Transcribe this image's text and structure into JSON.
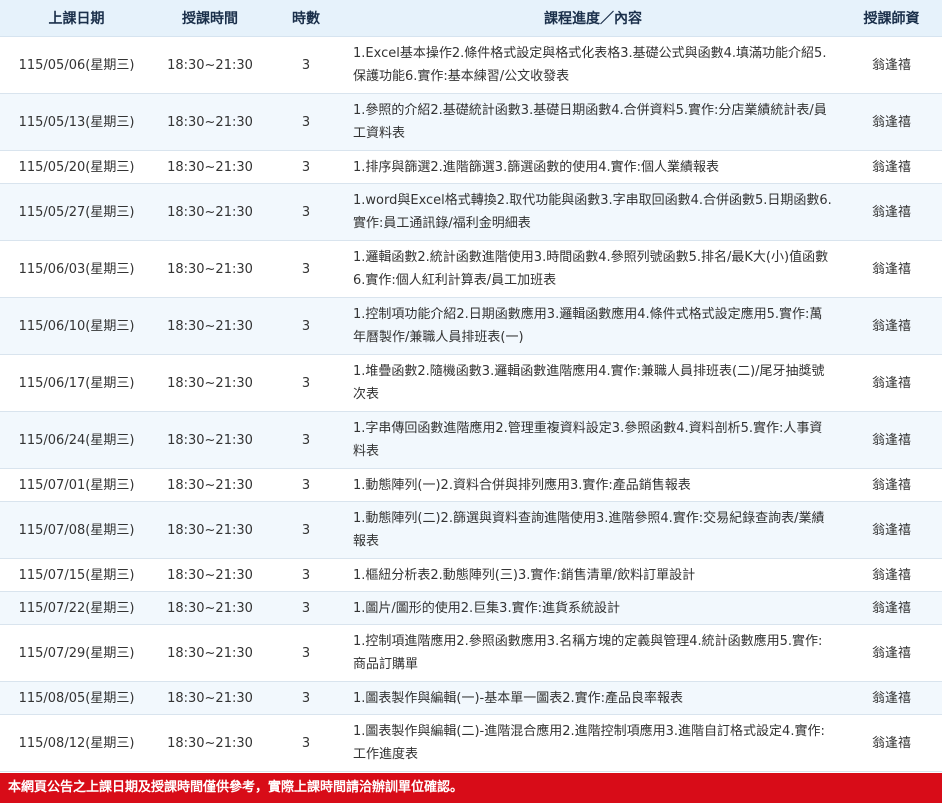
{
  "headers": [
    "上課日期",
    "授課時間",
    "時數",
    "課程進度／內容",
    "授課師資"
  ],
  "rows": [
    {
      "date": "115/05/06(星期三)",
      "time": "18:30~21:30",
      "hours": "3",
      "content": "1.Excel基本操作2.條件格式設定與格式化表格3.基礎公式與函數4.填滿功能介紹5.保護功能6.實作:基本練習/公文收發表",
      "teacher": "翁逢禧"
    },
    {
      "date": "115/05/13(星期三)",
      "time": "18:30~21:30",
      "hours": "3",
      "content": "1.參照的介紹2.基礎統計函數3.基礎日期函數4.合併資料5.實作:分店業績統計表/員工資料表",
      "teacher": "翁逢禧"
    },
    {
      "date": "115/05/20(星期三)",
      "time": "18:30~21:30",
      "hours": "3",
      "content": "1.排序與篩選2.進階篩選3.篩選函數的使用4.實作:個人業績報表",
      "teacher": "翁逢禧"
    },
    {
      "date": "115/05/27(星期三)",
      "time": "18:30~21:30",
      "hours": "3",
      "content": "1.word與Excel格式轉換2.取代功能與函數3.字串取回函數4.合併函數5.日期函數6.實作:員工通訊錄/福利金明細表",
      "teacher": "翁逢禧"
    },
    {
      "date": "115/06/03(星期三)",
      "time": "18:30~21:30",
      "hours": "3",
      "content": "1.邏輯函數2.統計函數進階使用3.時間函數4.參照列號函數5.排名/最K大(小)值函數6.實作:個人紅利計算表/員工加班表",
      "teacher": "翁逢禧"
    },
    {
      "date": "115/06/10(星期三)",
      "time": "18:30~21:30",
      "hours": "3",
      "content": "1.控制項功能介紹2.日期函數應用3.邏輯函數應用4.條件式格式設定應用5.實作:萬年曆製作/兼職人員排班表(一)",
      "teacher": "翁逢禧"
    },
    {
      "date": "115/06/17(星期三)",
      "time": "18:30~21:30",
      "hours": "3",
      "content": "1.堆疊函數2.隨機函數3.邏輯函數進階應用4.實作:兼職人員排班表(二)/尾牙抽獎號次表",
      "teacher": "翁逢禧"
    },
    {
      "date": "115/06/24(星期三)",
      "time": "18:30~21:30",
      "hours": "3",
      "content": "1.字串傳回函數進階應用2.管理重複資料設定3.參照函數4.資料剖析5.實作:人事資料表",
      "teacher": "翁逢禧"
    },
    {
      "date": "115/07/01(星期三)",
      "time": "18:30~21:30",
      "hours": "3",
      "content": "1.動態陣列(一)2.資料合併與排列應用3.實作:產品銷售報表",
      "teacher": "翁逢禧"
    },
    {
      "date": "115/07/08(星期三)",
      "time": "18:30~21:30",
      "hours": "3",
      "content": "1.動態陣列(二)2.篩選與資料查詢進階使用3.進階參照4.實作:交易紀錄查詢表/業績報表",
      "teacher": "翁逢禧"
    },
    {
      "date": "115/07/15(星期三)",
      "time": "18:30~21:30",
      "hours": "3",
      "content": "1.樞紐分析表2.動態陣列(三)3.實作:銷售清單/飲料訂單設計",
      "teacher": "翁逢禧"
    },
    {
      "date": "115/07/22(星期三)",
      "time": "18:30~21:30",
      "hours": "3",
      "content": "1.圖片/圖形的使用2.巨集3.實作:進貨系統設計",
      "teacher": "翁逢禧"
    },
    {
      "date": "115/07/29(星期三)",
      "time": "18:30~21:30",
      "hours": "3",
      "content": "1.控制項進階應用2.參照函數應用3.名稱方塊的定義與管理4.統計函數應用5.實作:商品訂購單",
      "teacher": "翁逢禧"
    },
    {
      "date": "115/08/05(星期三)",
      "time": "18:30~21:30",
      "hours": "3",
      "content": "1.圖表製作與編輯(一)-基本單一圖表2.實作:產品良率報表",
      "teacher": "翁逢禧"
    },
    {
      "date": "115/08/12(星期三)",
      "time": "18:30~21:30",
      "hours": "3",
      "content": "1.圖表製作與編輯(二)-進階混合應用2.進階控制項應用3.進階自訂格式設定4.實作:工作進度表",
      "teacher": "翁逢禧"
    }
  ],
  "notice": "本網頁公告之上課日期及授課時間僅供參考，實際上課時間請洽辦訓單位確認。",
  "colors": {
    "header_bg": "#e6f2fb",
    "row_alt_bg": "#f2f8fd",
    "notice_bg": "#d80c18",
    "notice_text": "#ffffff"
  }
}
